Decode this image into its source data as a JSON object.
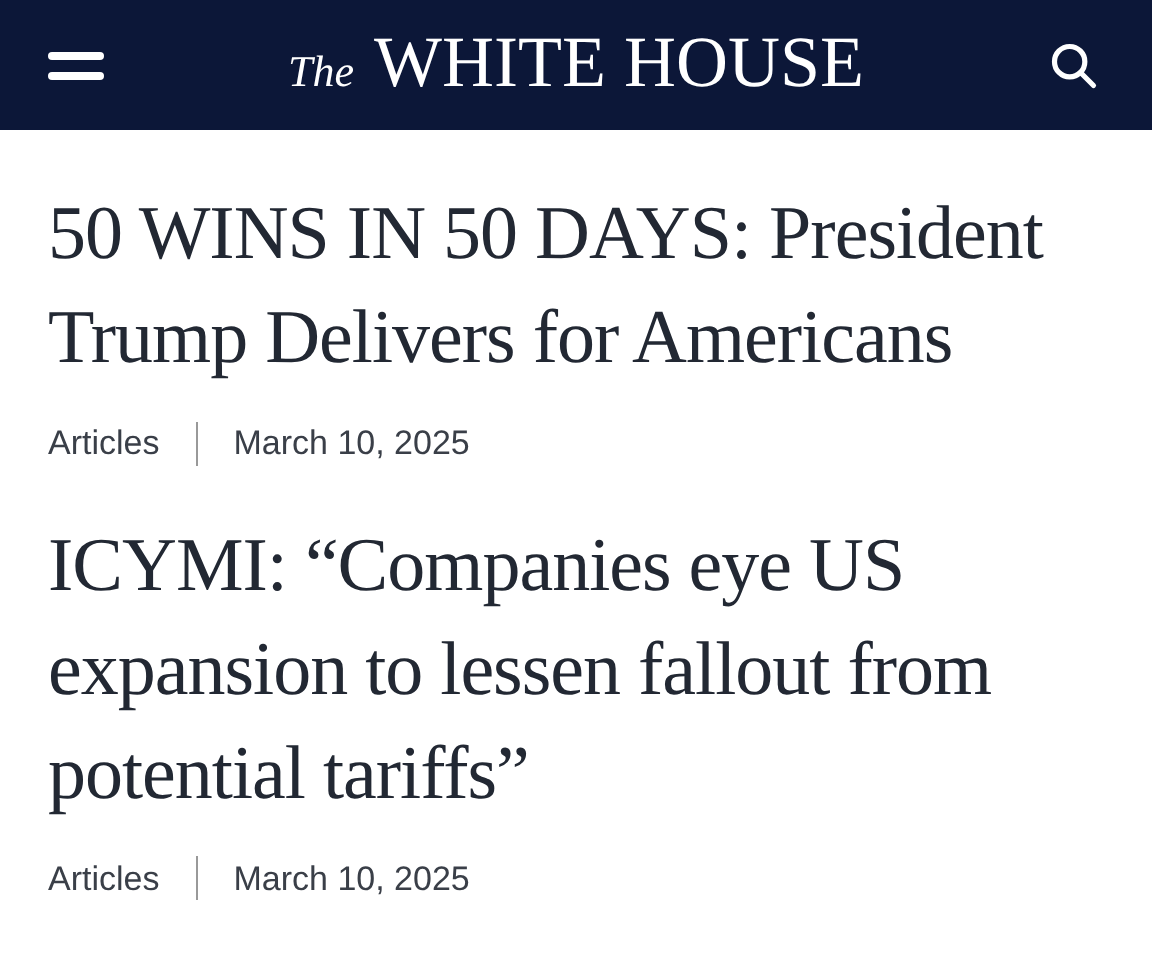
{
  "header": {
    "title_prefix": "The",
    "title": "WHITE HOUSE"
  },
  "articles": [
    {
      "title": "50 WINS IN 50 DAYS: President Trump Delivers for Americans",
      "category": "Articles",
      "date": "March 10, 2025"
    },
    {
      "title": "ICYMI: “Companies eye US expansion to lessen fallout from potential tariffs”",
      "category": "Articles",
      "date": "March 10, 2025"
    }
  ]
}
